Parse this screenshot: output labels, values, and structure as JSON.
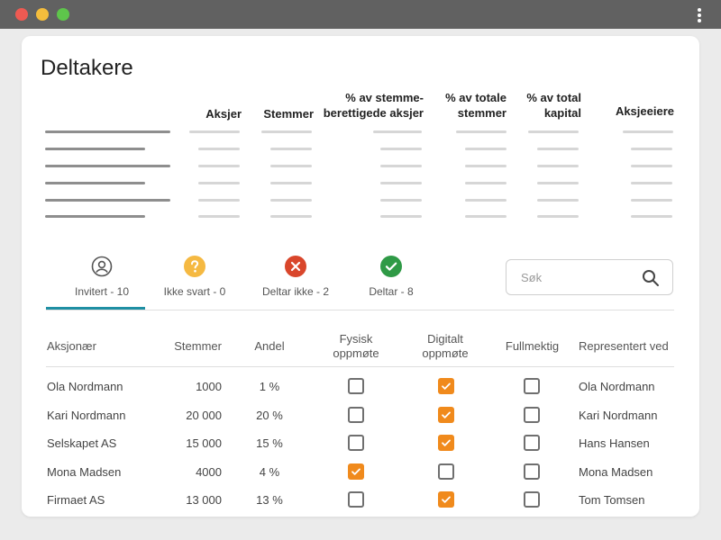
{
  "window": {
    "colors": {
      "close": "#ee5a52",
      "minimize": "#f4bd3c",
      "maximize": "#5ec54b",
      "chrome": "#616161"
    }
  },
  "page": {
    "title": "Deltakere"
  },
  "summary": {
    "headers": {
      "aksjer": "Aksjer",
      "stemmer": "Stemmer",
      "pct_stemmeberettigede_1": "% av stemme-",
      "pct_stemmeberettigede_2": "berettigede aksjer",
      "pct_totale_stemmer_1": "% av totale",
      "pct_totale_stemmer_2": "stemmer",
      "pct_total_kapital_1": "% av total",
      "pct_total_kapital_2": "kapital",
      "aksjeeiere": "Aksjeeiere"
    },
    "placeholder_rows": 6
  },
  "tabs": [
    {
      "label": "Invitert - 10",
      "icon": "person-circle-icon",
      "active": true
    },
    {
      "label": "Ikke svart - 0",
      "icon": "question-icon",
      "color": "#f5b942"
    },
    {
      "label": "Deltar ikke - 2",
      "icon": "x-circle-icon",
      "color": "#d9462b"
    },
    {
      "label": "Deltar - 8",
      "icon": "check-circle-icon",
      "color": "#2f9a46"
    }
  ],
  "search": {
    "placeholder": "Søk",
    "icon": "search-icon"
  },
  "table": {
    "headers": {
      "aksjonaer": "Aksjonær",
      "stemmer": "Stemmer",
      "andel": "Andel",
      "fysisk_1": "Fysisk",
      "fysisk_2": "oppmøte",
      "digitalt_1": "Digitalt",
      "digitalt_2": "oppmøte",
      "fullmektig": "Fullmektig",
      "representert": "Representert ved"
    },
    "rows": [
      {
        "name": "Ola Nordmann",
        "stemmer": "1000",
        "andel": "1 %",
        "fysisk": false,
        "digitalt": true,
        "fullmektig": false,
        "representert": "Ola Nordmann"
      },
      {
        "name": "Kari Nordmann",
        "stemmer": "20 000",
        "andel": "20 %",
        "fysisk": false,
        "digitalt": true,
        "fullmektig": false,
        "representert": "Kari Nordmann"
      },
      {
        "name": "Selskapet AS",
        "stemmer": "15 000",
        "andel": "15 %",
        "fysisk": false,
        "digitalt": true,
        "fullmektig": false,
        "representert": "Hans Hansen"
      },
      {
        "name": "Mona Madsen",
        "stemmer": "4000",
        "andel": "4 %",
        "fysisk": true,
        "digitalt": false,
        "fullmektig": false,
        "representert": "Mona Madsen"
      },
      {
        "name": "Firmaet AS",
        "stemmer": "13 000",
        "andel": "13 %",
        "fysisk": false,
        "digitalt": true,
        "fullmektig": false,
        "representert": "Tom Tomsen"
      }
    ]
  },
  "colors": {
    "accent": "#1e8fa3",
    "checkbox_checked": "#f08a1c"
  }
}
